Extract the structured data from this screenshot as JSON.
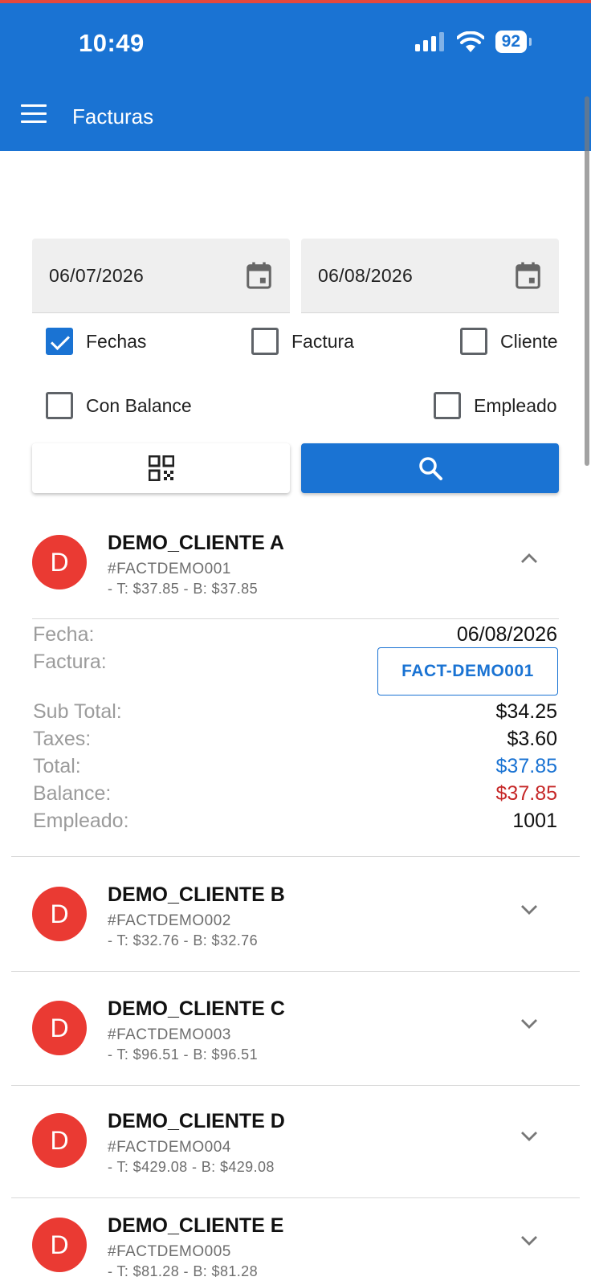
{
  "status_bar": {
    "time": "10:49",
    "battery": "92"
  },
  "app_bar": {
    "title": "Facturas"
  },
  "filters": {
    "date_from": "06/07/2026",
    "date_to": "06/08/2026",
    "checkboxes": {
      "fechas": {
        "label": "Fechas",
        "checked": true
      },
      "factura": {
        "label": "Factura",
        "checked": false
      },
      "cliente": {
        "label": "Cliente",
        "checked": false
      },
      "con_balance": {
        "label": "Con Balance",
        "checked": false
      },
      "empleado": {
        "label": "Empleado",
        "checked": false
      }
    }
  },
  "colors": {
    "primary": "#1a73d3",
    "avatar": "#ea3a33",
    "total": "#1a73d3",
    "balance": "#c62828"
  },
  "invoices": [
    {
      "avatar": "D",
      "client": "DEMO_CLIENTE A",
      "number": "#FACTDEMO001",
      "summary": "- T: $37.85 - B: $37.85",
      "expanded": true
    },
    {
      "avatar": "D",
      "client": "DEMO_CLIENTE B",
      "number": "#FACTDEMO002",
      "summary": "- T: $32.76 - B: $32.76",
      "expanded": false
    },
    {
      "avatar": "D",
      "client": "DEMO_CLIENTE C",
      "number": "#FACTDEMO003",
      "summary": "- T: $96.51 - B: $96.51",
      "expanded": false
    },
    {
      "avatar": "D",
      "client": "DEMO_CLIENTE D",
      "number": "#FACTDEMO004",
      "summary": "- T: $429.08 - B: $429.08",
      "expanded": false
    },
    {
      "avatar": "D",
      "client": "DEMO_CLIENTE E",
      "number": "#FACTDEMO005",
      "summary": "- T: $81.28 - B: $81.28",
      "expanded": false
    }
  ],
  "detail": {
    "fecha_label": "Fecha:",
    "fecha_value": "06/08/2026",
    "factura_label": "Factura:",
    "factura_button": "FACT-DEMO001",
    "subtotal_label": "Sub Total:",
    "subtotal_value": "$34.25",
    "taxes_label": "Taxes:",
    "taxes_value": "$3.60",
    "total_label": "Total:",
    "total_value": "$37.85",
    "balance_label": "Balance:",
    "balance_value": "$37.85",
    "empleado_label": "Empleado:",
    "empleado_value": "1001"
  },
  "icons": [
    "menu-icon",
    "calendar-icon",
    "qr-code-icon",
    "search-icon",
    "chevron-up-icon",
    "chevron-down-icon",
    "signal-icon",
    "wifi-icon"
  ]
}
